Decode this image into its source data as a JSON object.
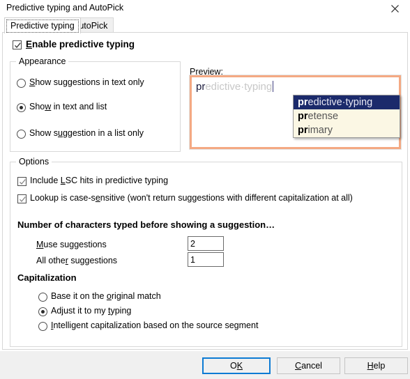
{
  "window": {
    "title": "Predictive typing and AutoPick",
    "close_icon": "close-icon"
  },
  "tabs": [
    {
      "label": "Predictive typing",
      "active": true
    },
    {
      "label": "AutoPick",
      "active": false
    }
  ],
  "enable": {
    "label_before": "E",
    "label_after": "nable predictive typing",
    "checked": true
  },
  "appearance": {
    "title": "Appearance",
    "options": [
      {
        "before": "",
        "accel": "S",
        "after": "how suggestions in text only",
        "selected": false
      },
      {
        "before": "Sho",
        "accel": "w",
        "after": " in text and list",
        "selected": true
      },
      {
        "before": "Show s",
        "accel": "u",
        "after": "ggestion in a list only",
        "selected": false
      }
    ]
  },
  "preview": {
    "label": "Preview:",
    "typed_prefix": "pr",
    "ghost_completion": "edictive·typing",
    "suggestions": [
      {
        "prefix": "pr",
        "rest": "edictive·typing",
        "selected": true
      },
      {
        "prefix": "pr",
        "rest": "etense",
        "selected": false
      },
      {
        "prefix": "pr",
        "rest": "imary",
        "selected": false
      }
    ]
  },
  "options": {
    "title": "Options",
    "checkboxes": [
      {
        "before": "Include ",
        "accel": "L",
        "after": "SC hits in predictive typing",
        "checked": true
      },
      {
        "before": "Lookup is case-s",
        "accel": "e",
        "after": "nsitive (won't return suggestions with different capitalization at all)",
        "checked": true
      }
    ],
    "chars_heading": "Number of characters typed before showing a suggestion…",
    "fields": [
      {
        "accel": "M",
        "label_after": "use suggestions",
        "value": "2"
      },
      {
        "before": "All othe",
        "accel": "r",
        "label_after": " suggestions",
        "value": "1"
      }
    ],
    "capitalization_heading": "Capitalization",
    "capitalization_options": [
      {
        "before": "Base it on the ",
        "accel": "o",
        "after": "riginal match",
        "selected": false
      },
      {
        "before": "Adjust it to my ",
        "accel": "t",
        "after": "yping",
        "selected": true
      },
      {
        "before": "",
        "accel": "I",
        "after": "ntelligent capitalization based on the source segment",
        "selected": false
      }
    ]
  },
  "footer": {
    "ok": {
      "before": "O",
      "accel": "K",
      "after": ""
    },
    "cancel": {
      "before": "",
      "accel": "C",
      "after": "ancel"
    },
    "help": {
      "before": "",
      "accel": "H",
      "after": "elp"
    }
  },
  "colors": {
    "preview_border": "#f4a983",
    "suggestion_bg": "#fbf7e4",
    "suggestion_selected_bg": "#1b2a6b",
    "default_button_border": "#0d7bd4"
  }
}
